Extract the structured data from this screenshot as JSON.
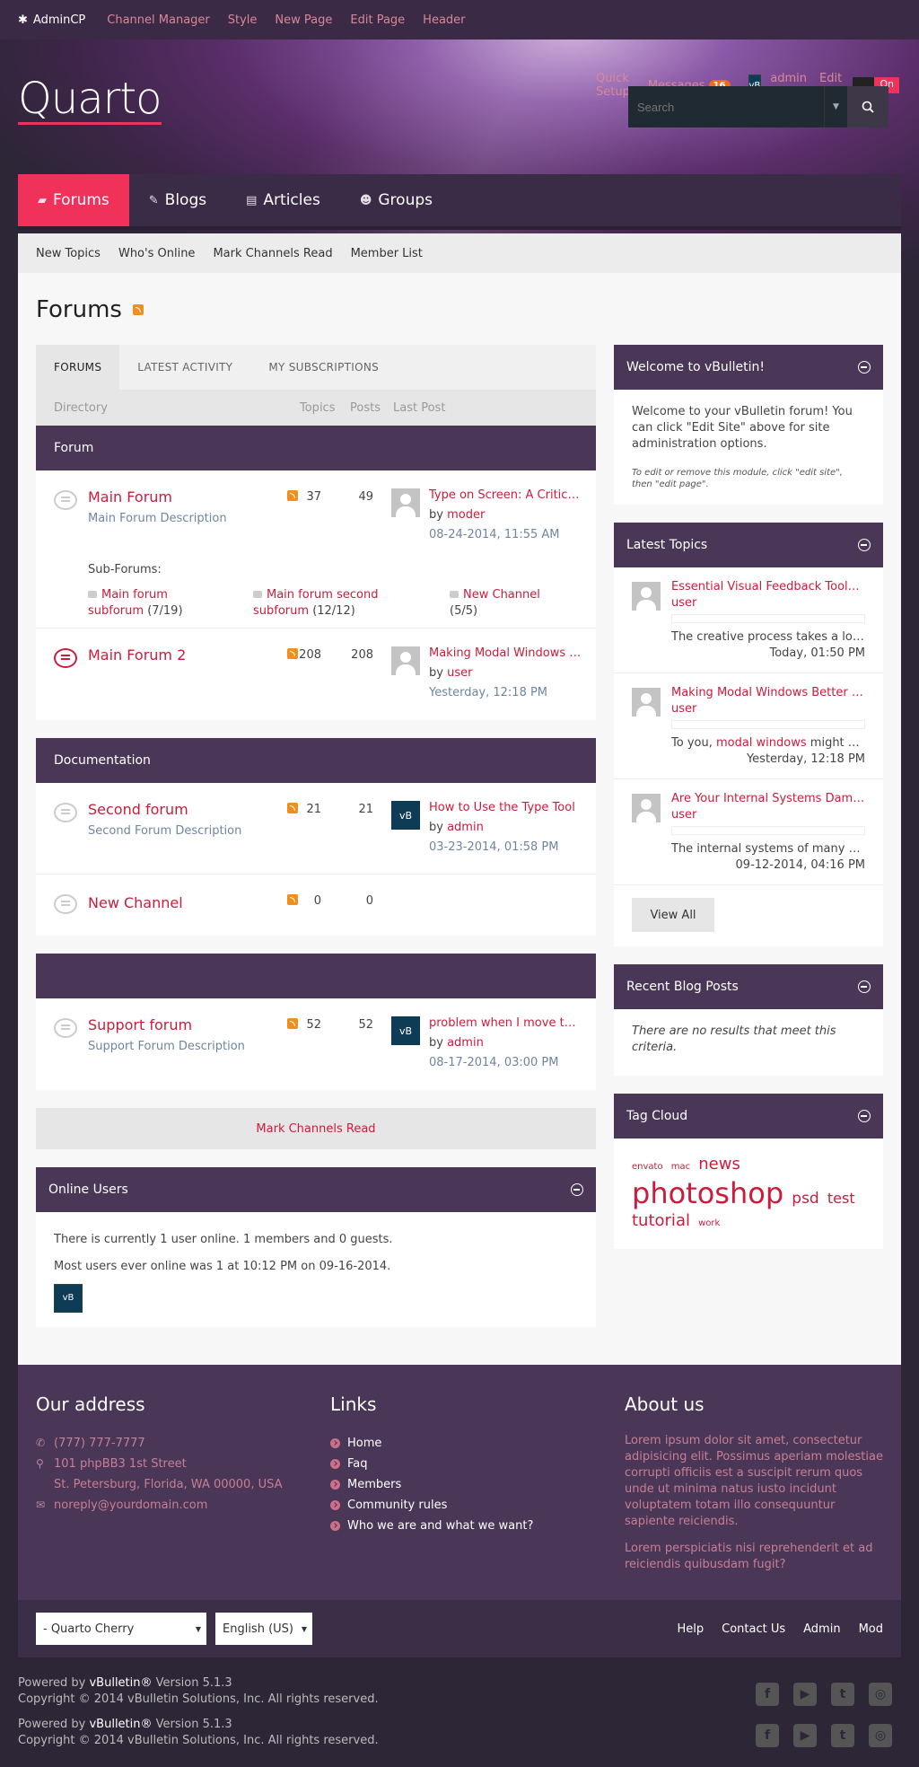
{
  "topbar": {
    "brand": "AdminCP",
    "links": [
      "Channel Manager",
      "Style",
      "New Page",
      "Edit Page",
      "Header"
    ],
    "quick_setup": "Quick Setup",
    "messages": "Messages",
    "messages_count": "16",
    "user": "admin",
    "edit_site": "Edit Site:",
    "toggle": "On"
  },
  "logo": "Quarto",
  "search": {
    "placeholder": "Search"
  },
  "nav": {
    "tabs": [
      "Forums",
      "Blogs",
      "Articles",
      "Groups"
    ]
  },
  "subnav": [
    "New Topics",
    "Who's Online",
    "Mark Channels Read",
    "Member List"
  ],
  "page_title": "Forums",
  "tabs": [
    "FORUMS",
    "LATEST ACTIVITY",
    "MY SUBSCRIPTIONS"
  ],
  "columns": {
    "directory": "Directory",
    "topics": "Topics",
    "posts": "Posts",
    "last_post": "Last Post"
  },
  "sections": {
    "forum": {
      "title": "Forum",
      "main": {
        "name": "Main Forum",
        "desc": "Main Forum Description",
        "topics": "37",
        "posts": "49",
        "last_title": "Type on Screen: A Critical Review",
        "by": "by",
        "user": "moder",
        "date": "08-24-2014, 11:55 AM"
      },
      "subforums_label": "Sub-Forums:",
      "subforums": [
        {
          "name1": "Main forum",
          "name2": "subforum",
          "count": "(7/19)"
        },
        {
          "name1": "Main forum second",
          "name2": "subforum",
          "count": "(12/12)"
        },
        {
          "name1": "New Channel",
          "name2": "",
          "count": "(5/5)"
        }
      ],
      "main2": {
        "name": "Main Forum 2",
        "topics": "208",
        "posts": "208",
        "last_title": "Making Modal Windows Better",
        "by": "by",
        "user": "user",
        "date": "Yesterday, 12:18 PM"
      }
    },
    "docs": {
      "title": "Documentation",
      "second": {
        "name": "Second forum",
        "desc": "Second Forum Description",
        "topics": "21",
        "posts": "21",
        "last_title": "How to Use the Type Tool",
        "by": "by",
        "user": "admin",
        "date": "03-23-2014, 01:58 PM"
      },
      "channel": {
        "name": "New Channel",
        "topics": "0",
        "posts": "0"
      }
    },
    "support": {
      "title": "",
      "forum": {
        "name": "Support forum",
        "desc": "Support Forum Description",
        "topics": "52",
        "posts": "52",
        "last_title": "problem when I move the cursor",
        "by": "by",
        "user": "admin",
        "date": "08-17-2014, 03:00 PM"
      }
    }
  },
  "mark_read": "Mark Channels Read",
  "online": {
    "title": "Online Users",
    "line1": "There is currently 1 user online. 1 members and 0 guests.",
    "line2": "Most users ever online was 1 at 10:12 PM on 09-16-2014."
  },
  "welcome": {
    "title": "Welcome to vBulletin!",
    "text": "Welcome to your vBulletin forum! You can click \"Edit Site\" above for site administration options.",
    "note": "To edit or remove this module, click \"edit site\", then \"edit page\"."
  },
  "latest": {
    "title": "Latest Topics",
    "items": [
      {
        "title": "Essential Visual Feedback Tools For Web Designers",
        "user": "user",
        "text": "The creative process takes a lot of time",
        "date": "Today, 01:50 PM"
      },
      {
        "title": "Making Modal Windows Better For Everyone",
        "user": "user",
        "pre": "To you, ",
        "link": "modal windows",
        "post": " might be a blessing",
        "date": "Yesterday, 12:18 PM"
      },
      {
        "title": "Are Your Internal Systems Damaging Productivity",
        "user": "user",
        "text": "The internal systems of many organizations",
        "date": "09-12-2014, 04:16 PM"
      }
    ],
    "view_all": "View All"
  },
  "blog": {
    "title": "Recent Blog Posts",
    "empty": "There are no results that meet this criteria."
  },
  "tags": {
    "title": "Tag Cloud",
    "items": [
      "envato",
      "mac",
      "news",
      "photoshop",
      "psd",
      "test",
      "tutorial",
      "work"
    ]
  },
  "footer": {
    "address_title": "Our address",
    "phone": "(777) 777-7777",
    "addr1": "101 phpBB3 1st Street",
    "addr2": "St. Petersburg, Florida, WA 00000, USA",
    "email": "noreply@yourdomain.com",
    "links_title": "Links",
    "links": [
      "Home",
      "Faq",
      "Members",
      "Community rules",
      "Who we are and what we want?"
    ],
    "about_title": "About us",
    "about1": "Lorem ipsum dolor sit amet, consectetur adipisicing elit. Possimus aperiam molestiae corrupti officiis est a suscipit rerum quos unde ut minima natus iusto incidunt voluptatem totam illo consequuntur sapiente reiciendis.",
    "about2": "Lorem perspiciatis nisi reprehenderit et ad reiciendis quibusdam fugit?"
  },
  "bottombar": {
    "style": "- Quarto Cherry",
    "lang": "English (US)",
    "links": [
      "Help",
      "Contact Us",
      "Admin",
      "Mod"
    ]
  },
  "copyright": {
    "powered_pre": "Powered by ",
    "powered_brand": "vBulletin®",
    "powered_post": " Version 5.1.3",
    "copy": "Copyright © 2014 vBulletin Solutions, Inc. All rights reserved."
  },
  "icons": {
    "accent": "#f0315a",
    "purple": "#4a3656",
    "link": "#cc1c3c"
  }
}
